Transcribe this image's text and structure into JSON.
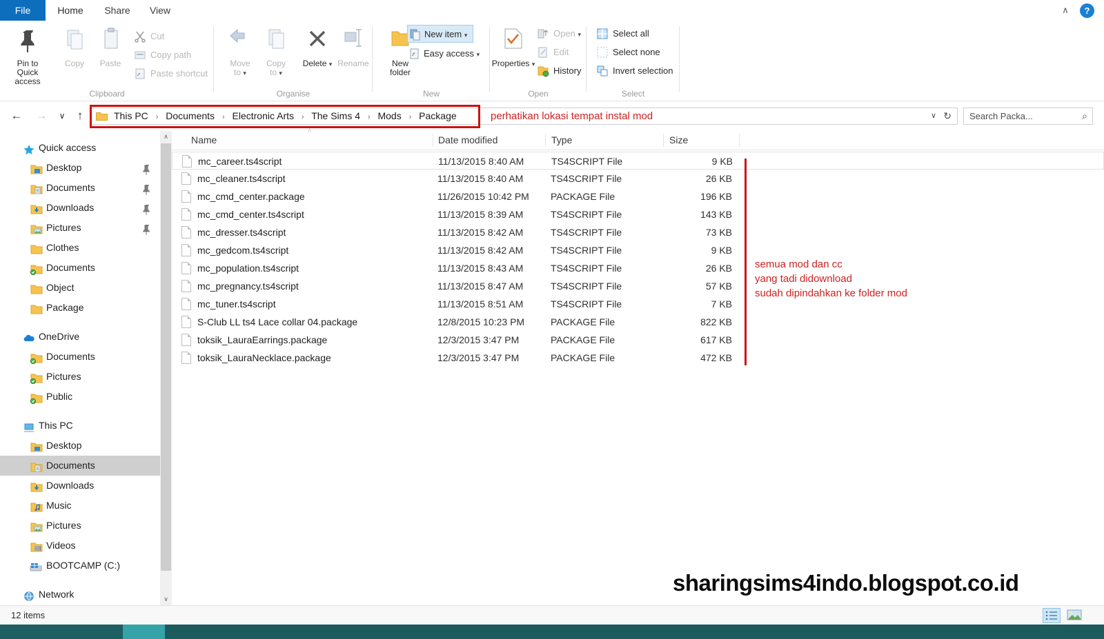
{
  "tabs": [
    {
      "id": "file",
      "label": "File"
    },
    {
      "id": "home",
      "label": "Home"
    },
    {
      "id": "share",
      "label": "Share"
    },
    {
      "id": "view",
      "label": "View"
    }
  ],
  "ribbon": {
    "help_label": "?",
    "collapse_label": "∧",
    "groups": [
      {
        "name": "Clipboard",
        "label": "Clipboard"
      },
      {
        "name": "Organise",
        "label": "Organise"
      },
      {
        "name": "New",
        "label": "New"
      },
      {
        "name": "Open",
        "label": "Open"
      },
      {
        "name": "Select",
        "label": "Select"
      }
    ],
    "clipboard": {
      "pin_label": "Pin to Quick\naccess",
      "pin_line1": "Pin to Quick",
      "pin_line2": "access",
      "copy_label": "Copy",
      "paste_label": "Paste",
      "cut_label": "Cut",
      "copy_path_label": "Copy path",
      "paste_shortcut_label": "Paste shortcut"
    },
    "organise": {
      "move_to_line1": "Move",
      "move_to_line2": "to",
      "copy_to_line1": "Copy",
      "copy_to_line2": "to",
      "delete_label": "Delete",
      "rename_label": "Rename"
    },
    "new": {
      "new_folder_line1": "New",
      "new_folder_line2": "folder",
      "new_item_label": "New item",
      "easy_access_label": "Easy access"
    },
    "open": {
      "properties_label": "Properties",
      "open_label": "Open",
      "edit_label": "Edit",
      "history_label": "History"
    },
    "select": {
      "select_all_label": "Select all",
      "select_none_label": "Select none",
      "invert_selection_label": "Invert selection"
    }
  },
  "address": {
    "back_icon": "←",
    "forward_icon": "→",
    "recent_icon": "∨",
    "up_icon": "↑",
    "breadcrumb": [
      "This PC",
      "Documents",
      "Electronic Arts",
      "The Sims 4",
      "Mods",
      "Package"
    ],
    "separator": "›",
    "dropdown_icon": "∨",
    "refresh_icon": "↻",
    "annotation": "perhatikan lokasi tempat instal mod"
  },
  "search": {
    "value": "Search Packa...",
    "icon": "⌕"
  },
  "sidebar": {
    "sections": [
      {
        "name": "quick-access",
        "header": "Quick access",
        "items": [
          {
            "label": "Desktop",
            "icon": "folder-desktop",
            "pinned": true,
            "selected": false
          },
          {
            "label": "Documents",
            "icon": "folder-documents",
            "pinned": true,
            "selected": false
          },
          {
            "label": "Downloads",
            "icon": "folder-downloads",
            "pinned": true,
            "selected": false
          },
          {
            "label": "Pictures",
            "icon": "folder-pictures",
            "pinned": true,
            "selected": false
          },
          {
            "label": "Clothes",
            "icon": "folder",
            "pinned": false,
            "selected": false
          },
          {
            "label": "Documents",
            "icon": "folder-synced",
            "pinned": false,
            "selected": false
          },
          {
            "label": "Object",
            "icon": "folder",
            "pinned": false,
            "selected": false
          },
          {
            "label": "Package",
            "icon": "folder",
            "pinned": false,
            "selected": false
          }
        ]
      },
      {
        "name": "onedrive",
        "header": "OneDrive",
        "items": [
          {
            "label": "Documents",
            "icon": "folder-synced",
            "pinned": false,
            "selected": false
          },
          {
            "label": "Pictures",
            "icon": "folder-synced",
            "pinned": false,
            "selected": false
          },
          {
            "label": "Public",
            "icon": "folder-synced",
            "pinned": false,
            "selected": false
          }
        ]
      },
      {
        "name": "this-pc",
        "header": "This PC",
        "items": [
          {
            "label": "Desktop",
            "icon": "folder-desktop",
            "pinned": false,
            "selected": false
          },
          {
            "label": "Documents",
            "icon": "folder-documents",
            "pinned": false,
            "selected": true
          },
          {
            "label": "Downloads",
            "icon": "folder-downloads",
            "pinned": false,
            "selected": false
          },
          {
            "label": "Music",
            "icon": "folder-music",
            "pinned": false,
            "selected": false
          },
          {
            "label": "Pictures",
            "icon": "folder-pictures",
            "pinned": false,
            "selected": false
          },
          {
            "label": "Videos",
            "icon": "folder-videos",
            "pinned": false,
            "selected": false
          },
          {
            "label": "BOOTCAMP (C:)",
            "icon": "drive",
            "pinned": false,
            "selected": false
          }
        ]
      },
      {
        "name": "network",
        "header": "Network",
        "items": []
      }
    ],
    "scroll_up_icon": "∧",
    "scroll_down_icon": "∨"
  },
  "filelist": {
    "columns": [
      "Name",
      "Date modified",
      "Type",
      "Size"
    ],
    "sort_indicator": "∧",
    "rows": [
      {
        "name": "mc_career.ts4script",
        "date": "11/13/2015 8:40 AM",
        "type": "TS4SCRIPT File",
        "size": "9 KB",
        "focus": true
      },
      {
        "name": "mc_cleaner.ts4script",
        "date": "11/13/2015 8:40 AM",
        "type": "TS4SCRIPT File",
        "size": "26 KB",
        "focus": false
      },
      {
        "name": "mc_cmd_center.package",
        "date": "11/26/2015 10:42 PM",
        "type": "PACKAGE File",
        "size": "196 KB",
        "focus": false
      },
      {
        "name": "mc_cmd_center.ts4script",
        "date": "11/13/2015 8:39 AM",
        "type": "TS4SCRIPT File",
        "size": "143 KB",
        "focus": false
      },
      {
        "name": "mc_dresser.ts4script",
        "date": "11/13/2015 8:42 AM",
        "type": "TS4SCRIPT File",
        "size": "73 KB",
        "focus": false
      },
      {
        "name": "mc_gedcom.ts4script",
        "date": "11/13/2015 8:42 AM",
        "type": "TS4SCRIPT File",
        "size": "9 KB",
        "focus": false
      },
      {
        "name": "mc_population.ts4script",
        "date": "11/13/2015 8:43 AM",
        "type": "TS4SCRIPT File",
        "size": "26 KB",
        "focus": false
      },
      {
        "name": "mc_pregnancy.ts4script",
        "date": "11/13/2015 8:47 AM",
        "type": "TS4SCRIPT File",
        "size": "57 KB",
        "focus": false
      },
      {
        "name": "mc_tuner.ts4script",
        "date": "11/13/2015 8:51 AM",
        "type": "TS4SCRIPT File",
        "size": "7 KB",
        "focus": false
      },
      {
        "name": "S-Club LL ts4 Lace collar 04.package",
        "date": "12/8/2015 10:23 PM",
        "type": "PACKAGE File",
        "size": "822 KB",
        "focus": false
      },
      {
        "name": "toksik_LauraEarrings.package",
        "date": "12/3/2015 3:47 PM",
        "type": "PACKAGE File",
        "size": "617 KB",
        "focus": false
      },
      {
        "name": "toksik_LauraNecklace.package",
        "date": "12/3/2015 3:47 PM",
        "type": "PACKAGE File",
        "size": "472 KB",
        "focus": false
      }
    ]
  },
  "annotations": {
    "right_line1": "semua mod dan cc",
    "right_line2": "yang tadi didownload",
    "right_line3": "sudah dipindahkan ke folder mod",
    "color": "#cc2222"
  },
  "watermark": "sharingsims4indo.blogspot.co.id",
  "status": {
    "item_count": "12 items",
    "view_details_icon": "details-view-icon",
    "view_large_icon": "large-icons-view-icon"
  }
}
